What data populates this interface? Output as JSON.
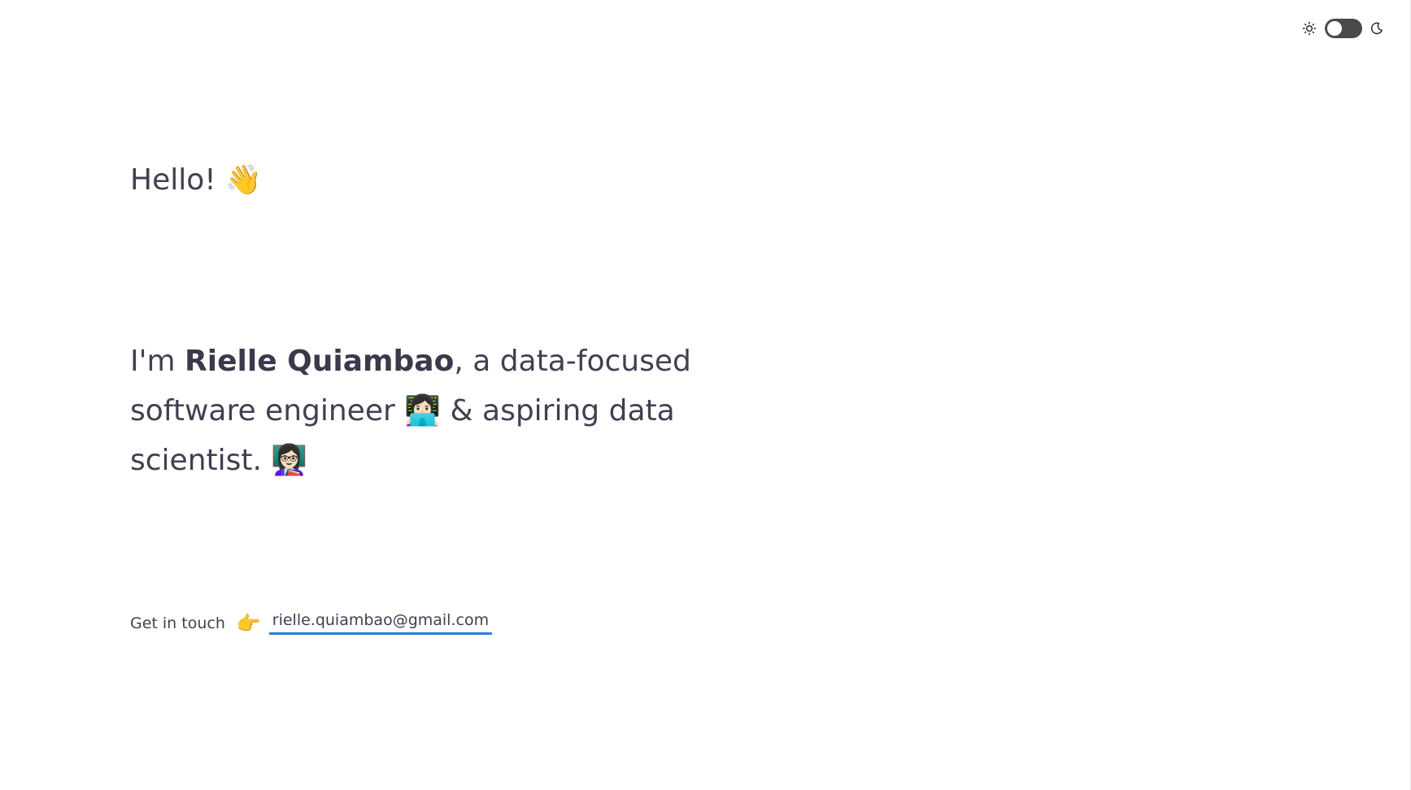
{
  "theme": {
    "light_icon": "sun-icon",
    "dark_icon": "moon-icon",
    "toggle_state": "off"
  },
  "hero": {
    "greeting": "Hello!",
    "greeting_emoji": "👋",
    "intro_prefix": "I'm ",
    "name": "Rielle Quiambao",
    "intro_middle": ", a data-focused software engineer ",
    "engineer_emoji": "👩🏻‍💻",
    "intro_suffix": " & aspiring data scientist. ",
    "scientist_emoji": "👩🏻‍🏫"
  },
  "contact": {
    "label": "Get in touch",
    "pointer_emoji": "👉",
    "email": "rielle.quiambao@gmail.com"
  },
  "colors": {
    "text": "#404052",
    "link_underline": "#2b7de0",
    "toggle_track": "#4a4a4a"
  }
}
